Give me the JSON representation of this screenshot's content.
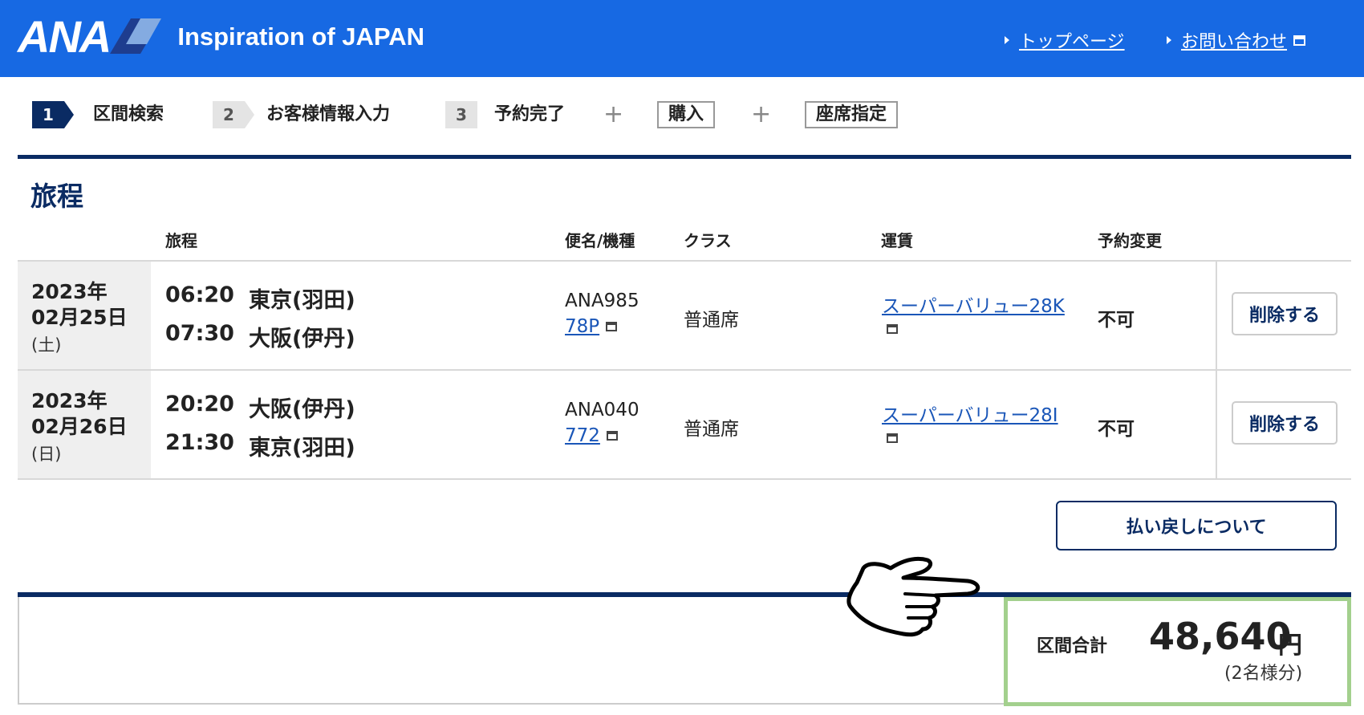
{
  "header": {
    "logo_text": "ANA",
    "tagline": "Inspiration of JAPAN",
    "links": [
      {
        "label": "トップページ",
        "icon": "triangle-right-icon"
      },
      {
        "label": "お問い合わせ",
        "icon": "triangle-right-icon",
        "external": true
      }
    ],
    "colors": {
      "bar": "#1769e3",
      "navy": "#0a2b63"
    }
  },
  "steps": [
    {
      "num": "1",
      "label": "区間検索",
      "active": true
    },
    {
      "num": "2",
      "label": "お客様情報入力",
      "active": false
    },
    {
      "num": "3",
      "label": "予約完了",
      "active": false
    }
  ],
  "extra_steps": [
    "購入",
    "座席指定"
  ],
  "plus": "+",
  "itinerary": {
    "title": "旅程",
    "columns": {
      "route": "旅程",
      "flight": "便名/機種",
      "class": "クラス",
      "fare": "運賃",
      "change": "予約変更"
    },
    "rows": [
      {
        "date_year": "2023年",
        "date_md": "02月25日",
        "day": "(土)",
        "dep_time": "06:20",
        "dep_place": "東京(羽田)",
        "arr_time": "07:30",
        "arr_place": "大阪(伊丹)",
        "flight": "ANA985",
        "aircraft": "78P",
        "class": "普通席",
        "fare": "スーパーバリュー28K",
        "change": "不可",
        "delete_label": "削除する"
      },
      {
        "date_year": "2023年",
        "date_md": "02月26日",
        "day": "(日)",
        "dep_time": "20:20",
        "dep_place": "大阪(伊丹)",
        "arr_time": "21:30",
        "arr_place": "東京(羽田)",
        "flight": "ANA040",
        "aircraft": "772",
        "class": "普通席",
        "fare": "スーパーバリュー28I",
        "change": "不可",
        "delete_label": "削除する"
      }
    ]
  },
  "refund_button": "払い戻しについて",
  "total": {
    "label": "区間合計",
    "amount": "48,640",
    "unit": "円",
    "note": "(2名様分)",
    "highlight_color": "#a3d08d"
  }
}
